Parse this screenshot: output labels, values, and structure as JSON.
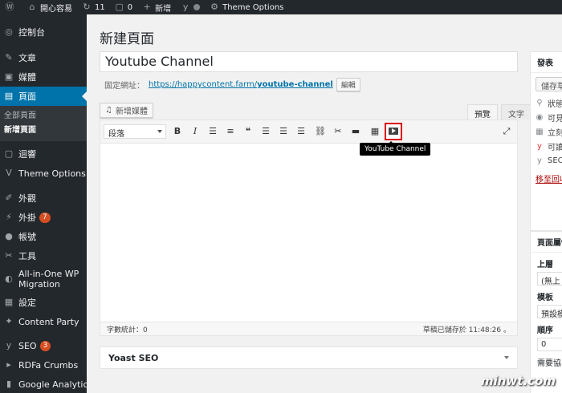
{
  "admin_bar": {
    "site_name": "開心容易",
    "updates_count": "11",
    "comments_count": "0",
    "new_label": "新增",
    "theme_options": "Theme Options"
  },
  "sidebar": {
    "items": [
      {
        "label": "控制台",
        "icon": "dashboard-icon"
      },
      {
        "label": "文章",
        "icon": "pin-icon"
      },
      {
        "label": "媒體",
        "icon": "media-icon"
      },
      {
        "label": "頁面",
        "icon": "page-icon"
      },
      {
        "label": "迴響",
        "icon": "comment-icon"
      },
      {
        "label": "Theme Options",
        "icon": "v-icon"
      },
      {
        "label": "外觀",
        "icon": "brush-icon"
      },
      {
        "label": "外掛",
        "icon": "plugin-icon",
        "badge": "7"
      },
      {
        "label": "帳號",
        "icon": "user-icon"
      },
      {
        "label": "工具",
        "icon": "wrench-icon"
      },
      {
        "label": "All-in-One WP Migration",
        "icon": "migration-icon"
      },
      {
        "label": "設定",
        "icon": "settings-icon"
      },
      {
        "label": "Content Party",
        "icon": "party-icon"
      },
      {
        "label": "SEO",
        "icon": "yoast-icon",
        "badge": "3"
      },
      {
        "label": "RDFa Crumbs",
        "icon": "arrow-icon"
      },
      {
        "label": "Google Analytics",
        "icon": "analytics-icon"
      }
    ],
    "submenu": {
      "all_pages": "全部頁面",
      "new_page": "新增頁面"
    }
  },
  "main": {
    "page_title": "新建頁面",
    "post_title": "Youtube Channel",
    "permalink_label": "固定網址：",
    "permalink_url": "https://happycontent.farm/",
    "permalink_slug": "youtube-channel",
    "edit_button": "編輯",
    "add_media": "新增媒體",
    "tab_visual": "預覽",
    "tab_text": "文字",
    "format_select": "段落",
    "tooltip": "YouTube Channel",
    "word_count": "字數統計：0",
    "draft_saved": "草稿已儲存於 11:48:26 。",
    "yoast_title": "Yoast SEO"
  },
  "publish_box": {
    "title": "發表",
    "save_draft": "儲存草",
    "rows": [
      "狀態",
      "可見",
      "立刻",
      "可讀",
      "SEO"
    ],
    "trash": "移至回收"
  },
  "attributes_box": {
    "title": "頁面屬性",
    "parent_label": "上層",
    "parent_value": "(無上",
    "template_label": "模板",
    "template_value": "預設模",
    "order_label": "順序",
    "order_value": "0",
    "help": "需要協"
  },
  "watermark": "minwt.com"
}
